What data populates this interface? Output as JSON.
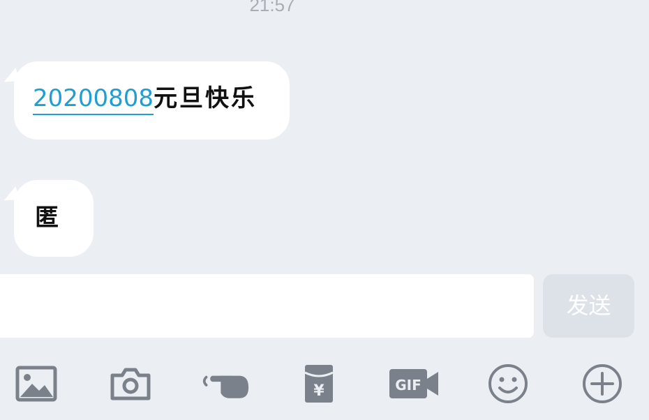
{
  "header": {
    "timestamp": "21:57"
  },
  "messages": [
    {
      "link_text": "20200808",
      "text": "元旦快乐"
    },
    {
      "text": "匿"
    }
  ],
  "composer": {
    "input_value": "",
    "send_label": "发送"
  },
  "toolbar": {
    "icons": [
      "image-icon",
      "camera-icon",
      "poke-icon",
      "red-packet-icon",
      "gif-icon",
      "emoji-icon",
      "plus-icon"
    ],
    "icon_color": "#7b818a"
  },
  "colors": {
    "background": "#ebeff4",
    "bubble": "#ffffff",
    "link": "#1f9ed2",
    "send_button": "#dde2e8"
  }
}
